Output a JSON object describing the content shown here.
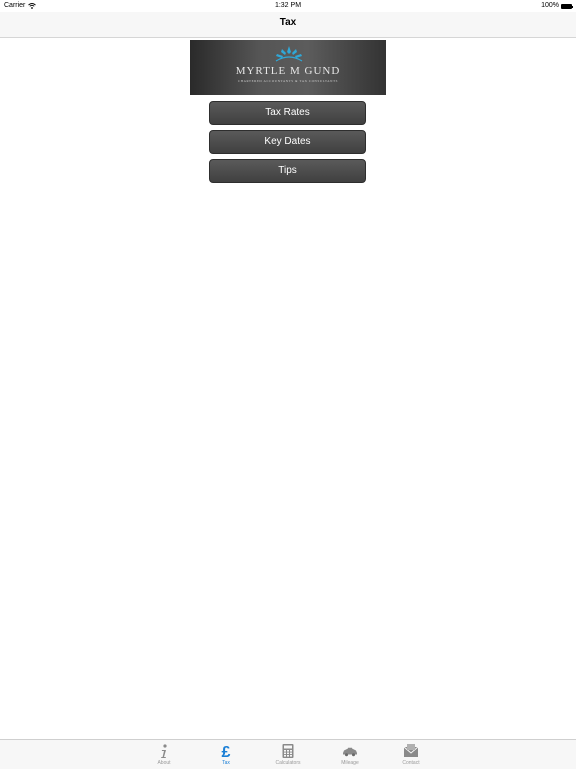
{
  "status_bar": {
    "carrier": "Carrier",
    "time": "1:32 PM",
    "battery": "100%"
  },
  "nav": {
    "title": "Tax"
  },
  "banner": {
    "brand": "MYRTLE M GUND",
    "tagline": "CHARTERED ACCOUNTANTS & TAX CONSULTANTS"
  },
  "menu": [
    {
      "label": "Tax Rates"
    },
    {
      "label": "Key Dates"
    },
    {
      "label": "Tips"
    }
  ],
  "tabs": [
    {
      "label": "About",
      "icon": "info-icon",
      "active": false
    },
    {
      "label": "Tax",
      "icon": "pound-icon",
      "active": true
    },
    {
      "label": "Calculators",
      "icon": "calculator-icon",
      "active": false
    },
    {
      "label": "Mileage",
      "icon": "car-icon",
      "active": false
    },
    {
      "label": "Contact",
      "icon": "envelope-icon",
      "active": false
    }
  ],
  "colors": {
    "active_tab": "#1a7fd6",
    "inactive_tab": "#999999",
    "button": "#4a4a4a"
  }
}
